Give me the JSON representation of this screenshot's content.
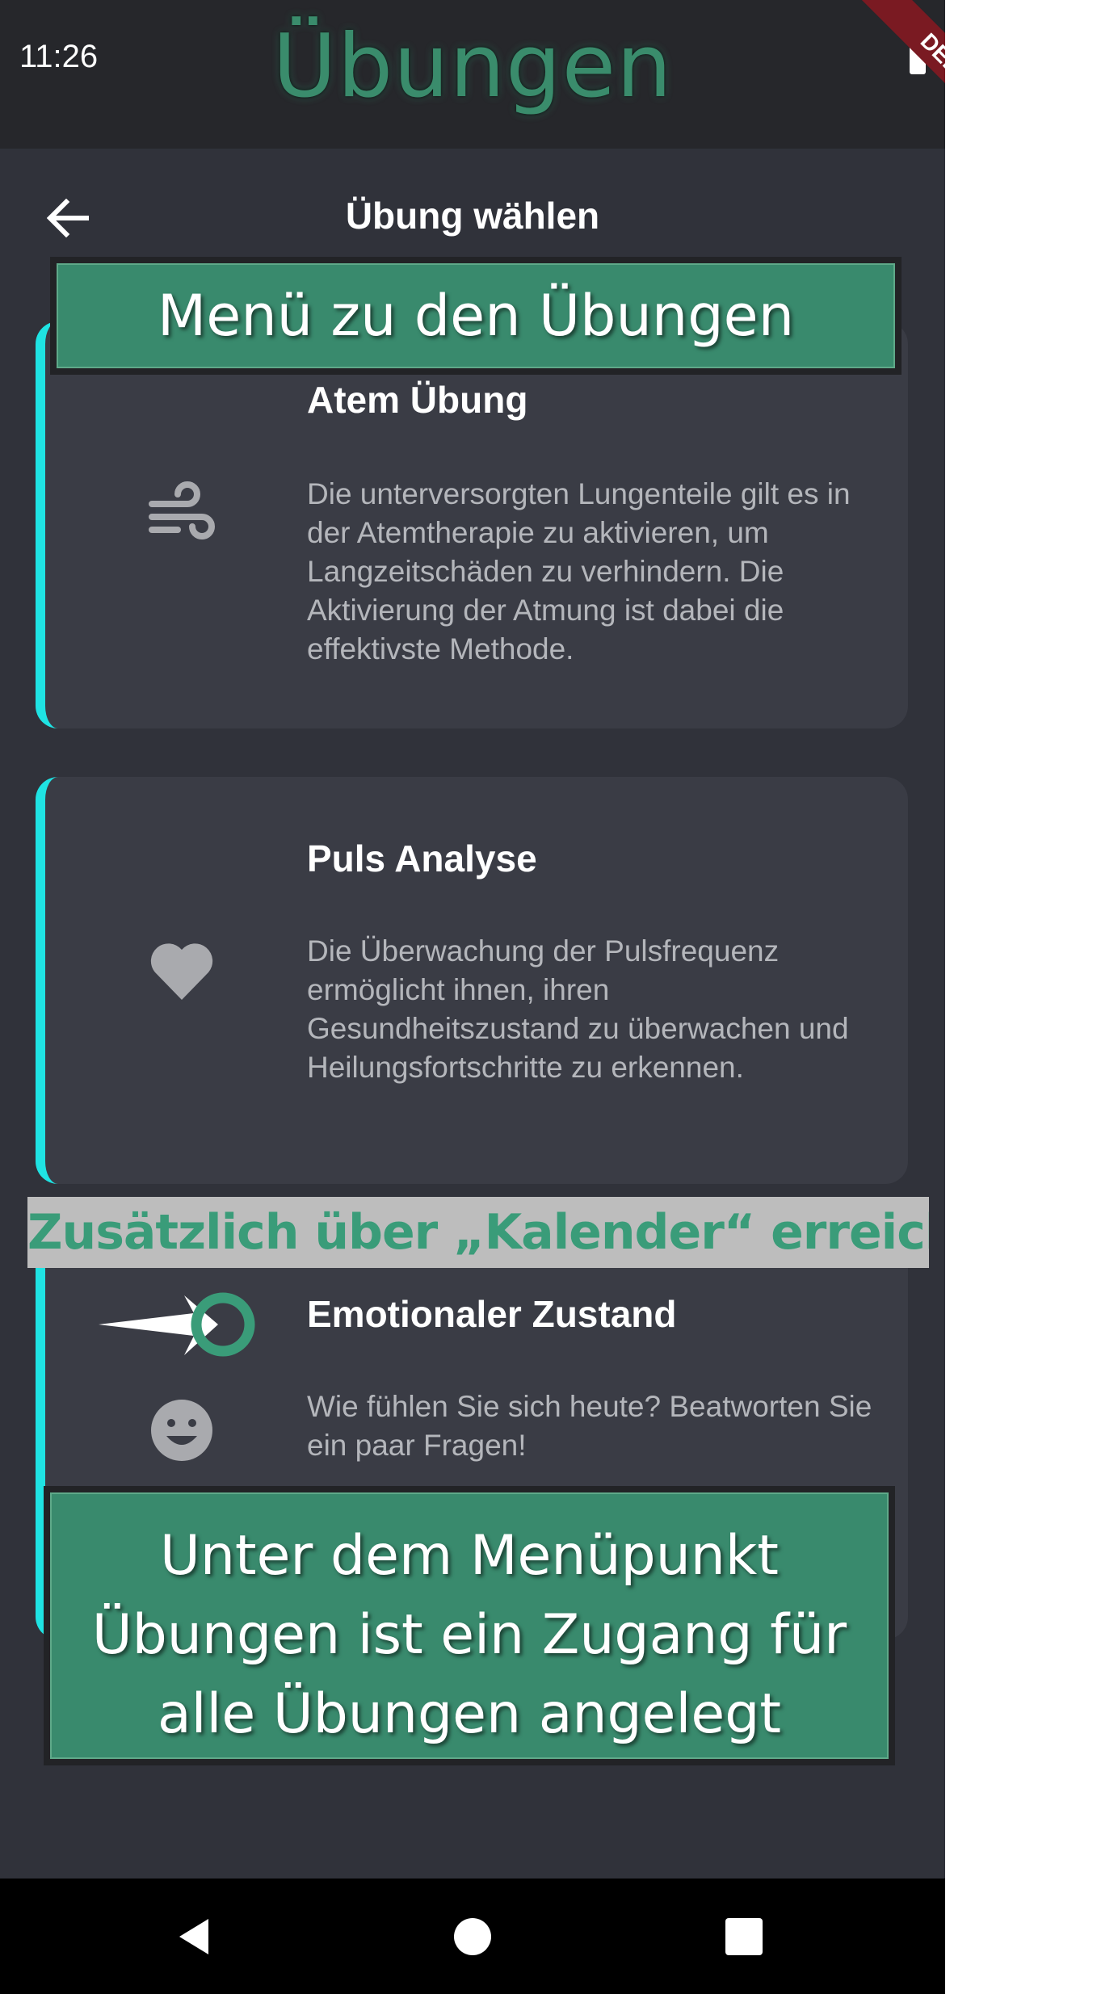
{
  "status_bar": {
    "time": "11:26",
    "debug_label": "DEBUG"
  },
  "app": {
    "title": "Übungen"
  },
  "header": {
    "title": "Übung wählen",
    "back_icon": "arrow-back-icon"
  },
  "cards": [
    {
      "title": "Atem Übung",
      "description": "Die unterversorgten Lungenteile gilt es in der Atemtherapie zu aktivieren, um Langzeitschäden zu verhindern. Die Aktivierung der Atmung ist dabei die effektivste Methode.",
      "icon": "wind-icon"
    },
    {
      "title": "Puls Analyse",
      "description": "Die Überwachung der Pulsfrequenz ermöglicht ihnen, ihren Gesundheitszustand zu überwachen und Heilungsfortschritte zu erkennen.",
      "icon": "heart-icon"
    },
    {
      "title": "Emotionaler Zustand",
      "description": "Wie fühlen Sie sich heute? Beatworten Sie ein paar Fragen!",
      "icon": "smiley-icon"
    }
  ],
  "annotations": {
    "top_banner": "Menü zu den Übungen",
    "calendar_note": "Zusätzlich über „Kalender“ erreichbar",
    "bottom_banner_lines": [
      "Unter dem Menüpunkt",
      "Übungen ist ein Zugang für",
      "alle Übungen angelegt"
    ]
  },
  "colors": {
    "background": "#30323a",
    "card": "#3a3c45",
    "accent_cyan": "#1fe3e3",
    "banner_green": "#398a6d",
    "title_green": "#3a8c6c"
  },
  "nav": {
    "back": "nav-back-icon",
    "home": "nav-home-icon",
    "recents": "nav-recents-icon"
  }
}
